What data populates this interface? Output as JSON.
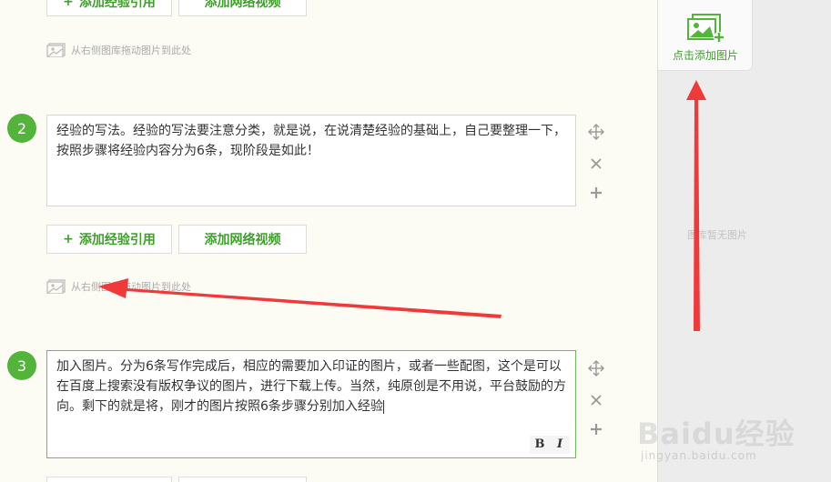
{
  "sidebar": {
    "add_image_label": "点击添加图片",
    "empty_text": "图库暂无图片"
  },
  "buttons": {
    "add_reference": "添加经验引用",
    "add_reference_plus": "+",
    "add_video": "添加网络视频"
  },
  "drop_hint": "从右侧图库拖动图片到此处",
  "steps": [
    {
      "number": "2",
      "text": "经验的写法。经验的写法要注意分类，就是说，在说清楚经验的基础上，自己要整理一下，按照步骤将经验内容分为6条，现阶段是如此！"
    },
    {
      "number": "3",
      "text": "加入图片。分为6条写作完成后，相应的需要加入印证的图片，或者一些配图，这个是可以在百度上搜索没有版权争议的图片，进行下载上传。当然，纯原创是不用说，平台鼓励的方向。剩下的就是将，刚才的图片按照6条步骤分别加入经验"
    }
  ],
  "format_bar": {
    "bold": "B",
    "italic": "I"
  },
  "watermark": {
    "logo": "Baidu经验",
    "url": "jingyan.baidu.com"
  },
  "colors": {
    "accent": "#52b43a",
    "arrow": "#f03a3a",
    "background": "#fcfcf5"
  }
}
